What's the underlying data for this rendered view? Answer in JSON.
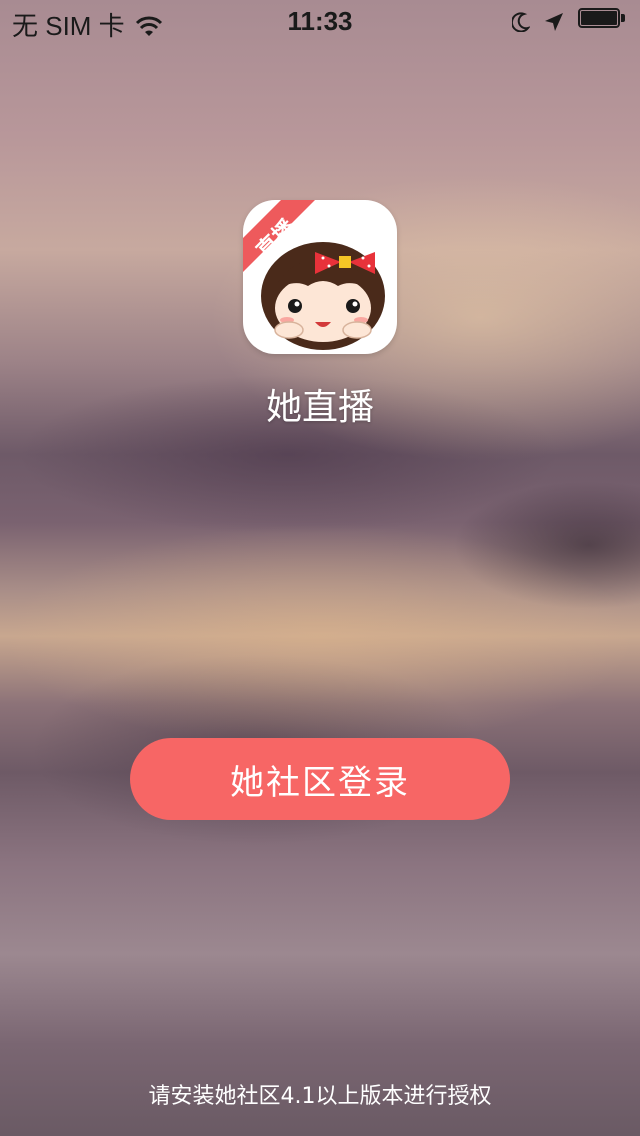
{
  "status_bar": {
    "carrier": "无 SIM 卡",
    "time": "11:33",
    "icons": [
      "wifi-icon",
      "moon-icon",
      "location-icon",
      "battery-icon"
    ]
  },
  "app": {
    "icon_ribbon": "直播",
    "name": "她直播"
  },
  "login": {
    "button_label": "她社区登录"
  },
  "footer": {
    "note": "请安装她社区4.1以上版本进行授权"
  },
  "colors": {
    "accent": "#f76665",
    "ribbon": "#ee5a5c",
    "text": "#ffffff"
  }
}
